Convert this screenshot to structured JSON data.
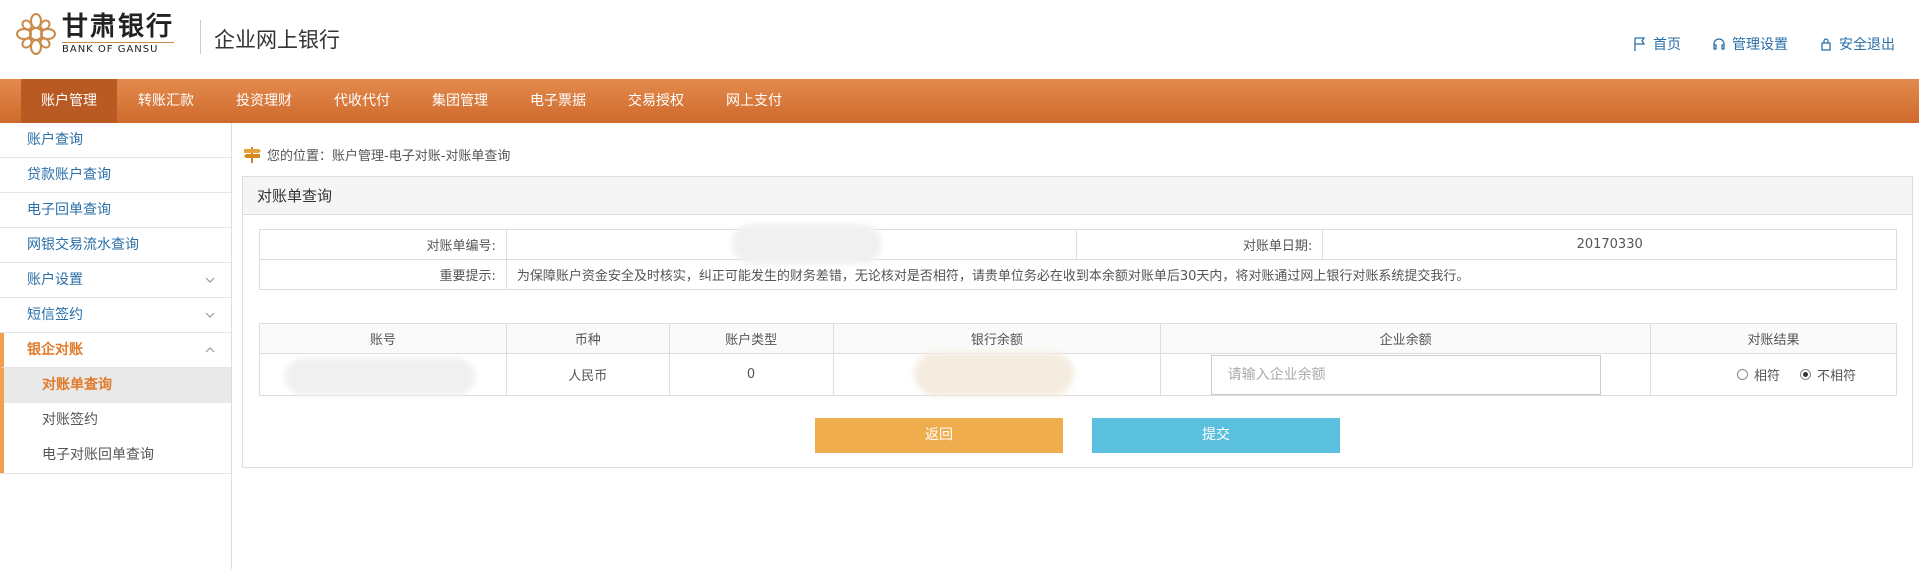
{
  "brand": {
    "name_cn": "甘肃银行",
    "name_en": "BANK OF GANSU",
    "app_title": "企业网上银行",
    "accent": "#d9753a"
  },
  "top_links": [
    {
      "label": "首页",
      "icon": "flag-icon"
    },
    {
      "label": "管理设置",
      "icon": "headset-icon"
    },
    {
      "label": "安全退出",
      "icon": "lock-icon"
    }
  ],
  "nav": [
    {
      "label": "账户管理",
      "active": true
    },
    {
      "label": "转账汇款"
    },
    {
      "label": "投资理财"
    },
    {
      "label": "代收代付"
    },
    {
      "label": "集团管理"
    },
    {
      "label": "电子票据"
    },
    {
      "label": "交易授权"
    },
    {
      "label": "网上支付"
    }
  ],
  "sidebar": {
    "items": [
      {
        "label": "账户查询"
      },
      {
        "label": "贷款账户查询"
      },
      {
        "label": "电子回单查询"
      },
      {
        "label": "网银交易流水查询"
      },
      {
        "label": "账户设置"
      },
      {
        "label": "短信签约"
      },
      {
        "label": "银企对账"
      }
    ],
    "subitems": [
      {
        "label": "对账单查询",
        "active": true
      },
      {
        "label": "对账签约"
      },
      {
        "label": "电子对账回单查询"
      }
    ]
  },
  "breadcrumb": "您的位置：账户管理-电子对账-对账单查询",
  "panel": {
    "title": "对账单查询",
    "info": {
      "statement_no_label": "对账单编号:",
      "statement_date_label": "对账单日期:",
      "statement_date": "20170330",
      "notice_label": "重要提示:",
      "notice_text": "为保障账户资金安全及时核实，纠正可能发生的财务差错，无论核对是否相符，请贵单位务必在收到本余额对账单后30天内，将对账通过网上银行对账系统提交我行。"
    },
    "table": {
      "headers": [
        "账号",
        "币种",
        "账户类型",
        "银行余额",
        "企业余额",
        "对账结果"
      ],
      "row": {
        "currency": "人民币",
        "account_type": "0",
        "enterprise_balance_placeholder": "请输入企业余额",
        "result_options": [
          "相符",
          "不相符"
        ],
        "result_selected": "不相符"
      }
    },
    "buttons": {
      "back": "返回",
      "submit": "提交"
    }
  }
}
